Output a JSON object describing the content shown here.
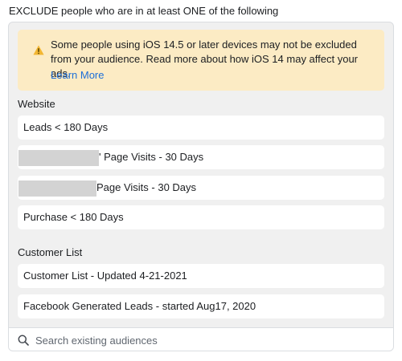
{
  "heading": "EXCLUDE people who are in at least ONE of the following",
  "warning": {
    "icon": "warning-triangle-icon",
    "color": "#fcebc4",
    "text": "Some people using iOS 14.5 or later devices may not be excluded from your audience. Read more about how iOS 14 may affect your ads.",
    "link": "Learn More"
  },
  "sections": [
    {
      "label": "Website",
      "items": [
        {
          "label": "Leads < 180 Days"
        },
        {
          "label": "' Page Visits - 30 Days",
          "redacted": true
        },
        {
          "label": "Page Visits - 30 Days",
          "redacted": true
        },
        {
          "label": "Purchase < 180 Days"
        }
      ]
    },
    {
      "label": "Customer List",
      "items": [
        {
          "label": "Customer List - Updated 4-21-2021"
        },
        {
          "label": "Facebook Generated Leads - started Aug17, 2020"
        }
      ]
    }
  ],
  "search": {
    "icon": "search-icon",
    "placeholder": "Search existing audiences",
    "value": ""
  }
}
